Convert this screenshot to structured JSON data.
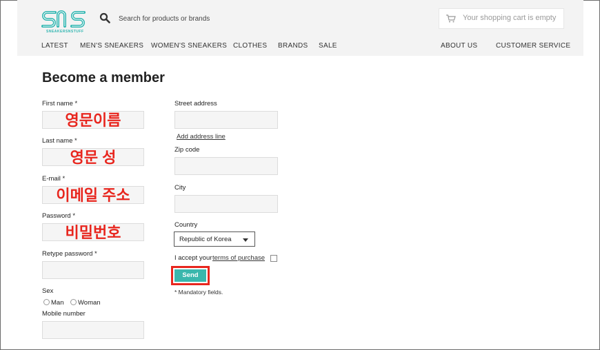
{
  "header": {
    "logo_tagline": "SNEAKERSNSTUFF",
    "search_placeholder": "Search for products or brands",
    "cart_text": "Your shopping cart is empty",
    "nav_left": [
      "LATEST",
      "MEN'S SNEAKERS",
      "WOMEN'S SNEAKERS",
      "CLOTHES",
      "BRANDS",
      "SALE"
    ],
    "nav_right": [
      "ABOUT US",
      "CUSTOMER SERVICE"
    ]
  },
  "form": {
    "title": "Become a member",
    "first_name": {
      "label": "First name *",
      "value": "영문이름"
    },
    "last_name": {
      "label": "Last name *",
      "value": "영문 성"
    },
    "email": {
      "label": "E-mail *",
      "value": "이메일 주소"
    },
    "password": {
      "label": "Password *",
      "value": "비밀번호"
    },
    "retype_password": {
      "label": "Retype password *",
      "value": ""
    },
    "sex": {
      "label": "Sex",
      "options": [
        "Man",
        "Woman"
      ]
    },
    "mobile": {
      "label": "Mobile number",
      "value": ""
    },
    "street": {
      "label": "Street address",
      "value": ""
    },
    "add_address_line": "Add address line",
    "zip": {
      "label": "Zip code",
      "value": ""
    },
    "city": {
      "label": "City",
      "value": ""
    },
    "country": {
      "label": "Country",
      "selected": "Republic of Korea"
    },
    "terms_prefix": "I accept your",
    "terms_link": "terms of purchase",
    "send_label": "Send",
    "mandatory_note": "* Mandatory fields."
  },
  "colors": {
    "accent": "#3ab7ad",
    "annotation": "#e8261e",
    "header_bg": "#f3f3f3"
  }
}
